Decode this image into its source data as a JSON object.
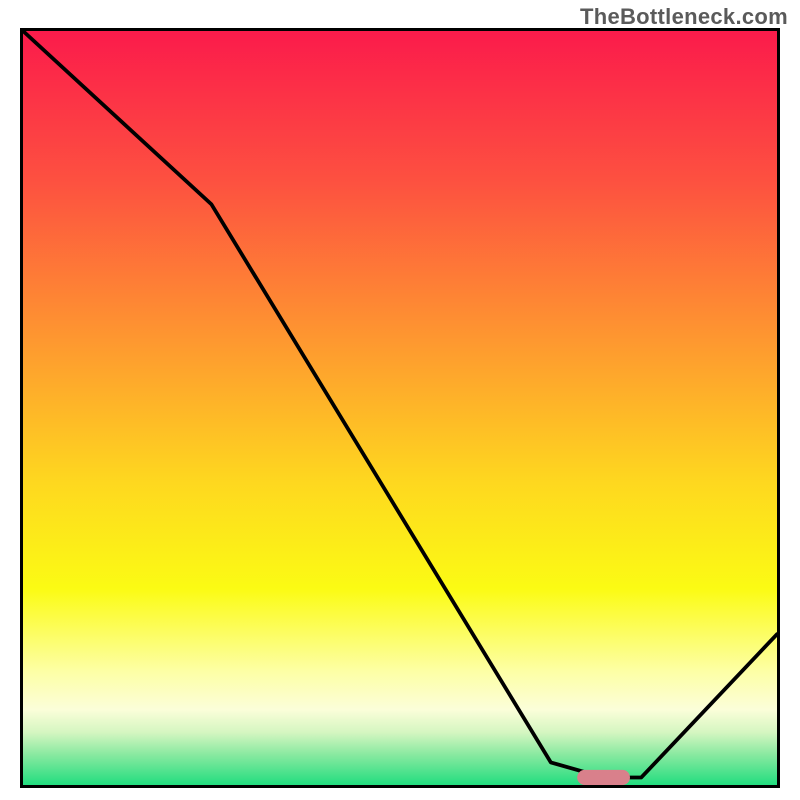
{
  "watermark": "TheBottleneck.com",
  "chart_data": {
    "type": "line",
    "title": "",
    "xlabel": "",
    "ylabel": "",
    "xlim": [
      0,
      100
    ],
    "ylim": [
      0,
      100
    ],
    "series": [
      {
        "name": "bottleneck-curve",
        "x": [
          0,
          25,
          70,
          77,
          82,
          100
        ],
        "y": [
          100,
          77,
          3,
          1,
          1,
          20
        ]
      }
    ],
    "annotations": [
      {
        "name": "optimal-marker",
        "x": 77,
        "width": 7,
        "y": 1,
        "color": "#d9808b"
      }
    ],
    "background_gradient": {
      "stops": [
        {
          "offset": 0.0,
          "color": "#fb1b4b"
        },
        {
          "offset": 0.2,
          "color": "#fd5140"
        },
        {
          "offset": 0.42,
          "color": "#fe9b2f"
        },
        {
          "offset": 0.6,
          "color": "#fed81f"
        },
        {
          "offset": 0.74,
          "color": "#fbfb14"
        },
        {
          "offset": 0.85,
          "color": "#fdffa6"
        },
        {
          "offset": 0.9,
          "color": "#fbfed9"
        },
        {
          "offset": 0.93,
          "color": "#d5f6c1"
        },
        {
          "offset": 0.96,
          "color": "#88e9a0"
        },
        {
          "offset": 1.0,
          "color": "#22dd7f"
        }
      ]
    }
  }
}
